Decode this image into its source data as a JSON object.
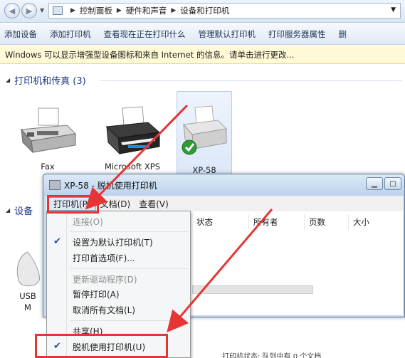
{
  "explorer": {
    "breadcrumbs": [
      "控制面板",
      "硬件和声音",
      "设备和打印机"
    ],
    "toolbar": [
      "添加设备",
      "添加打印机",
      "查看现在正在打印什么",
      "管理默认打印机",
      "打印服务器属性",
      "删"
    ],
    "info_bar": "Windows 可以显示增强型设备图标和来自 Internet 的信息。请单击进行更改...",
    "group_printers": "打印机和传真 (3)",
    "group_devices": "设备",
    "devices": [
      {
        "label": "Fax",
        "icon": "fax-icon"
      },
      {
        "label": "Microsoft XPS",
        "icon": "printer-icon"
      },
      {
        "label": "XP-58",
        "icon": "printer-icon",
        "default": true
      }
    ],
    "usb_label_line1": "USB",
    "usb_label_line2": "M",
    "status_text": "打印机状态: 队列中有 0 个文档"
  },
  "queue_window": {
    "title": "XP-58 - 脱机使用打印机",
    "menus": [
      "打印机(P)",
      "文档(D)",
      "查看(V)"
    ],
    "columns": [
      "状态",
      "所有者",
      "页数",
      "大小"
    ]
  },
  "printer_menu": {
    "items": [
      {
        "label": "连接(O)",
        "disabled": true
      },
      {
        "label": "设置为默认打印机(T)",
        "checked": true
      },
      {
        "label": "打印首选项(F)..."
      },
      {
        "label": "更新驱动程序(D)",
        "disabled": true
      },
      {
        "label": "暂停打印(A)"
      },
      {
        "label": "取消所有文档(L)"
      },
      {
        "label": "共享(H)"
      },
      {
        "label": "脱机使用打印机(U)",
        "checked": true
      }
    ]
  },
  "colors": {
    "annotation_red": "#e63535",
    "accent_blue": "#1e3b8a",
    "check_blue": "#1e4fa3"
  }
}
